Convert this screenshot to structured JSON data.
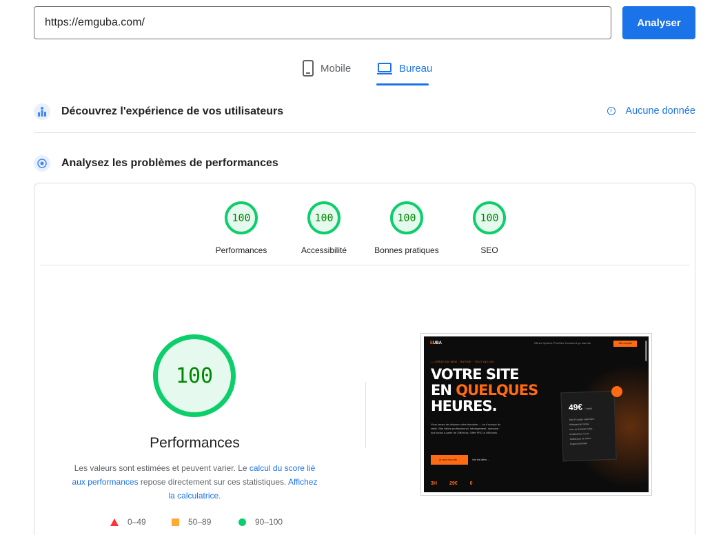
{
  "search": {
    "url": "https://emguba.com/",
    "analyze_label": "Analyser"
  },
  "tabs": [
    {
      "label": "Mobile",
      "icon": "phone-icon",
      "selected": false
    },
    {
      "label": "Bureau",
      "icon": "laptop-icon",
      "selected": true
    }
  ],
  "field_data": {
    "title": "Découvrez l'expérience de vos utilisateurs",
    "status": "Aucune donnée"
  },
  "lab": {
    "title": "Analysez les problèmes de performances",
    "scores": [
      {
        "label": "Performances",
        "value": "100"
      },
      {
        "label": "Accessibilité",
        "value": "100"
      },
      {
        "label": "Bonnes pratiques",
        "value": "100"
      },
      {
        "label": "SEO",
        "value": "100"
      }
    ],
    "main_score": "100",
    "main_label": "Performances",
    "desc": {
      "part1": "Les valeurs sont estimées et peuvent varier. Le ",
      "link1": "calcul du score lié aux performances",
      "part2": " repose directement sur ces statistiques. ",
      "link2": "Affichez la calculatrice",
      "part3": "."
    },
    "legend": [
      {
        "range": "0–49",
        "color": "#ff3333"
      },
      {
        "range": "50–89",
        "color": "#ffaa33"
      },
      {
        "range": "90–100",
        "color": "#0cce6b"
      }
    ]
  },
  "thumbnail": {
    "logo_prefix": "E",
    "logo_suffix": "UBA",
    "nav": "Offres    Options    Portfolio    Comment ça marche",
    "top_cta": "Site complet",
    "kicker": "— CRÉATION WEB · RAPIDE · TOUT INCLUS",
    "hero_line1": "VOTRE SITE",
    "hero_line2a": "EN ",
    "hero_line2b": "QUELQUES",
    "hero_line3": "HEURES.",
    "para": "Vous venez de déposer votre domaine — on s'occupe du reste. Site vitrine professionnel, hébergement, domaine : tout inclus à partir de 29€/mois. Offre PRO à 49€/mois.",
    "cta": "Je veux mon site →",
    "link": "Voir les offres →",
    "stats": [
      "3H",
      "29€",
      "0"
    ],
    "price": "49€",
    "price_unit": "/ mois",
    "features": [
      "Site 8-5 pages responsive",
      "Hébergement inclus",
      "Nom de domaine inclus",
      "Modifications / mois",
      "Statistiques de visites",
      "Support prioritaire"
    ]
  },
  "colors": {
    "accent": "#1a73e8",
    "pass": "#0cce6b",
    "average": "#ffaa33",
    "fail": "#ff3333",
    "brand_orange": "#ff6a13"
  }
}
